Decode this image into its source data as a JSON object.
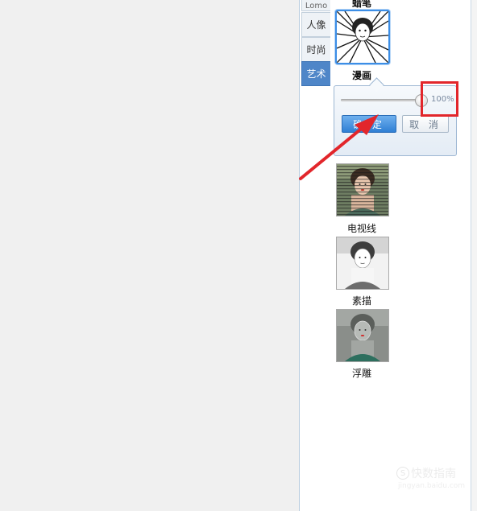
{
  "panel": {
    "tabs": [
      {
        "label": "Lomo",
        "active": false
      },
      {
        "label": "人像",
        "active": false
      },
      {
        "label": "时尚",
        "active": false
      },
      {
        "label": "艺术",
        "active": true
      }
    ],
    "top_caption": "蜡笔",
    "effects": [
      {
        "label": "漫画",
        "selected": true
      },
      {
        "label": "电视线",
        "selected": false
      },
      {
        "label": "素描",
        "selected": false
      },
      {
        "label": "浮雕",
        "selected": false
      }
    ]
  },
  "popover": {
    "slider_value": "100%",
    "slider_level": 1.0,
    "ok_label": "确 定",
    "cancel_label": "取 消"
  },
  "annotation": {
    "highlight_color": "#e2262b"
  },
  "watermark": {
    "main": "快数指南",
    "sub": "jingyan.baidu.com"
  },
  "colors": {
    "accent": "#3c8ee6",
    "active_tab": "#4f86c8",
    "annotation_red": "#e2262b"
  }
}
